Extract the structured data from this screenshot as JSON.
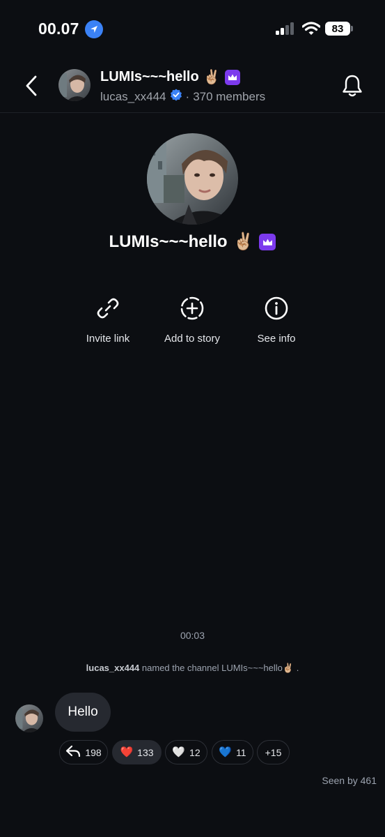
{
  "status_bar": {
    "time": "00.07",
    "battery": "83",
    "icons": [
      "location-arrow-icon",
      "signal-icon",
      "wifi-icon",
      "battery-icon"
    ]
  },
  "header": {
    "title": "LUMIs~~~hello",
    "title_emoji": "✌🏼",
    "username": "lucas_xx444",
    "separator": "·",
    "members": "370 members"
  },
  "profile": {
    "name": "LUMIs~~~hello",
    "name_emoji": "✌🏼"
  },
  "actions": [
    {
      "label": "Invite link",
      "icon": "link-icon"
    },
    {
      "label": "Add to story",
      "icon": "add-story-icon"
    },
    {
      "label": "See info",
      "icon": "info-icon"
    }
  ],
  "chat": {
    "timestamp": "00:03",
    "system_message": {
      "user": "lucas_xx444",
      "text": "named the channel LUMIs~~~hello",
      "emoji": "✌🏼",
      "end": "."
    },
    "message": "Hello",
    "reactions": [
      {
        "emoji": "",
        "icon": "reply-icon",
        "count": "198"
      },
      {
        "emoji": "❤️",
        "count": "133"
      },
      {
        "emoji": "🤍",
        "count": "12"
      },
      {
        "emoji": "💙",
        "count": "11"
      },
      {
        "emoji": "",
        "count": "+15"
      }
    ],
    "seen": "Seen by 461"
  },
  "colors": {
    "background": "#0c0e12",
    "accent_blue": "#3b82f6",
    "crown_purple": "#7c3aed",
    "bubble": "#262930"
  }
}
